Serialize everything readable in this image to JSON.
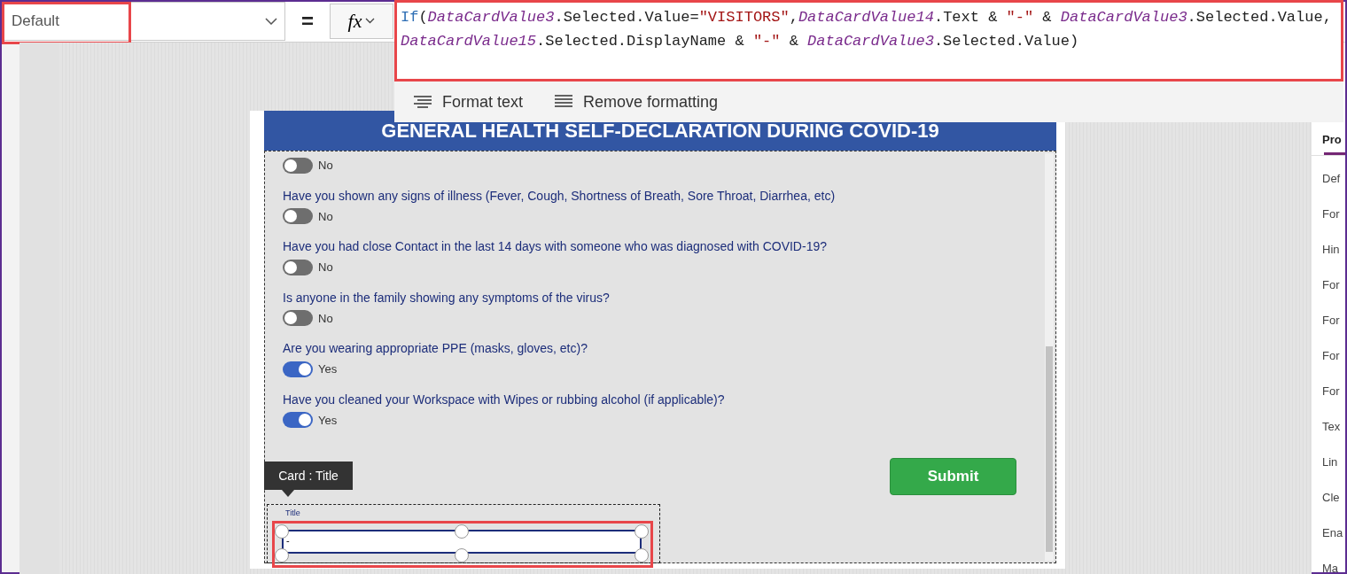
{
  "property_dropdown": {
    "value": "Default"
  },
  "formula_bar": {
    "equals": "=",
    "fx": "fx",
    "lines": [
      [
        {
          "kind": "function",
          "text": "If"
        },
        {
          "kind": "plain",
          "text": "("
        },
        {
          "kind": "var",
          "text": "DataCardValue3"
        },
        {
          "kind": "plain",
          "text": ".Selected.Value="
        },
        {
          "kind": "string",
          "text": "\"VISITORS\""
        },
        {
          "kind": "plain",
          "text": ","
        },
        {
          "kind": "var",
          "text": "DataCardValue14"
        },
        {
          "kind": "plain",
          "text": ".Text & "
        },
        {
          "kind": "string",
          "text": "\"-\""
        },
        {
          "kind": "plain",
          "text": " & "
        },
        {
          "kind": "var",
          "text": "DataCardValue3"
        },
        {
          "kind": "plain",
          "text": ".Selected.Value,"
        }
      ],
      [
        {
          "kind": "var",
          "text": "DataCardValue15"
        },
        {
          "kind": "plain",
          "text": ".Selected.DisplayName & "
        },
        {
          "kind": "string",
          "text": "\"-\""
        },
        {
          "kind": "plain",
          "text": " & "
        },
        {
          "kind": "var",
          "text": "DataCardValue3"
        },
        {
          "kind": "plain",
          "text": ".Selected.Value)"
        }
      ]
    ],
    "actions": [
      {
        "kind": "format",
        "label": "Format text"
      },
      {
        "kind": "remove",
        "label": "Remove formatting"
      }
    ]
  },
  "form": {
    "title": "GENERAL HEALTH SELF-DECLARATION DURING COVID-19",
    "questions": [
      {
        "toggle": "No",
        "on": false
      },
      {
        "question": "Have you shown any signs of illness (Fever, Cough, Shortness of Breath, Sore Throat, Diarrhea, etc)",
        "toggle": "No",
        "on": false
      },
      {
        "question": "Have you had close Contact in the last 14 days with someone who was diagnosed with COVID-19?",
        "toggle": "No",
        "on": false
      },
      {
        "question": "Is anyone in the family showing any symptoms of the virus?",
        "toggle": "No",
        "on": false
      },
      {
        "question": "Are you wearing appropriate PPE (masks, gloves, etc)?",
        "toggle": "Yes",
        "on": true
      },
      {
        "question": "Have you cleaned your Workspace with Wipes or rubbing alcohol (if applicable)?",
        "toggle": "Yes",
        "on": true
      }
    ],
    "submit": "Submit",
    "tooltip": "Card : Title",
    "title_card": {
      "label": "Title",
      "value": "-"
    }
  },
  "properties_panel": {
    "tab": "Pro",
    "items": [
      "Def",
      "For",
      "Hin",
      "For",
      "For",
      "For",
      "For",
      "Tex",
      "Lin",
      "Cle",
      "Ena",
      "Ma"
    ]
  }
}
